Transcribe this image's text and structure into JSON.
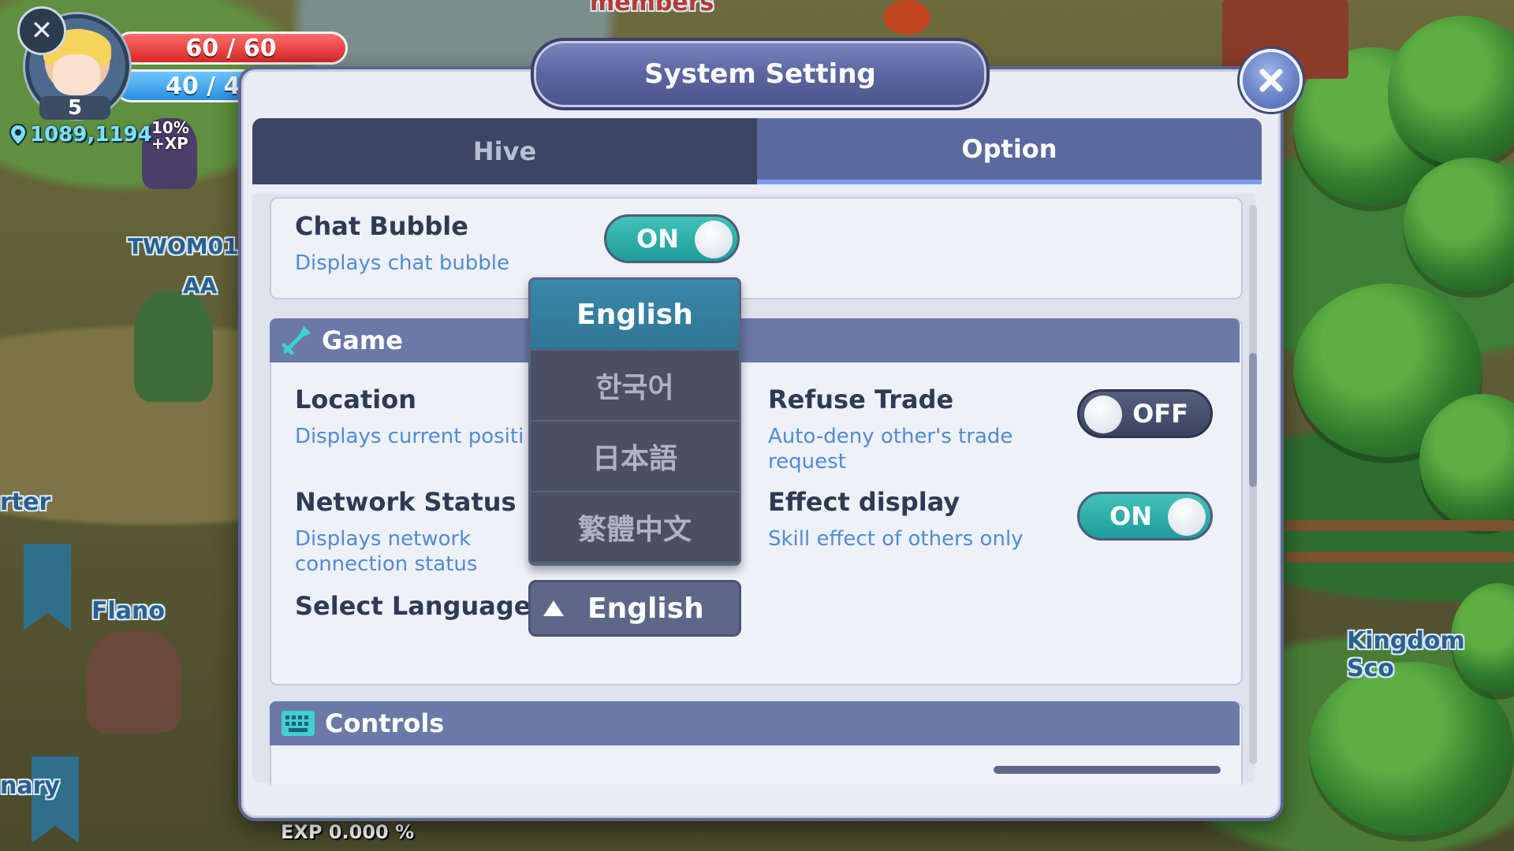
{
  "hud": {
    "hp": "60 / 60",
    "mp": "40 / 4",
    "level": "5",
    "coordinates": "1089,1194",
    "exp": "EXP 0.000 %"
  },
  "world_labels": {
    "guild_tag": "TWOM01",
    "player_aa": "AA",
    "flano": "Flano",
    "kingdom": "Kingdom Sco",
    "porter": "rter",
    "nary": "nary",
    "members": "members",
    "buff_xp": "10% +XP"
  },
  "dialog": {
    "title": "System Setting",
    "tabs": [
      {
        "label": "Hive",
        "active": false
      },
      {
        "label": "Option",
        "active": true
      }
    ],
    "chat_bubble": {
      "title": "Chat Bubble",
      "desc": "Displays chat bubble",
      "toggle": "ON"
    },
    "game_section": {
      "header": "Game",
      "location": {
        "title": "Location",
        "desc": "Displays current positi"
      },
      "network_status": {
        "title": "Network Status",
        "desc_line1": "Displays network",
        "desc_line2": "connection status"
      },
      "refuse_trade": {
        "title": "Refuse Trade",
        "desc_line1": "Auto-deny other's trade",
        "desc_line2": "request",
        "toggle": "OFF"
      },
      "effect_display": {
        "title": "Effect display",
        "desc": "Skill effect of others only",
        "toggle": "ON"
      },
      "select_language": {
        "title": "Select Language",
        "value": "English"
      }
    },
    "language_options": [
      "English",
      "한국어",
      "日本語",
      "繁體中文"
    ],
    "selected_language": "English",
    "controls_section": {
      "header": "Controls"
    }
  },
  "colors": {
    "panel": "#e9ecf4",
    "tab_active": "#5a6a9e",
    "tab_inactive": "#3c4563",
    "toggle_on": "#2fb0ab",
    "toggle_off": "#454e6b",
    "desc_text": "#4f8bd8",
    "hp": "#e03a3a",
    "mp": "#3aa2ee"
  },
  "icons": {
    "close": "close-icon",
    "game": "sword-icon",
    "controls": "keyboard-icon",
    "language_arrow": "triangle-up-icon",
    "location": "pin-icon"
  }
}
